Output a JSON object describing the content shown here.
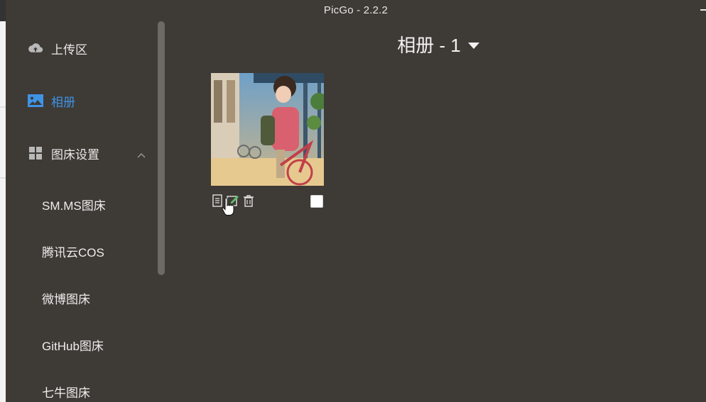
{
  "window": {
    "title": "PicGo - 2.2.2"
  },
  "sidebar": {
    "items": [
      {
        "label": "上传区",
        "icon": "cloud-upload-icon"
      },
      {
        "label": "相册",
        "icon": "image-icon",
        "active": true
      },
      {
        "label": "图床设置",
        "icon": "grid-icon",
        "expanded": true
      }
    ],
    "subitems": [
      {
        "label": "SM.MS图床"
      },
      {
        "label": "腾讯云COS"
      },
      {
        "label": "微博图床"
      },
      {
        "label": "GitHub图床"
      },
      {
        "label": "七牛图床"
      }
    ]
  },
  "main": {
    "album_title": "相册 - 1",
    "images": [
      {
        "alt": "anime girl with bicycle",
        "selected": false
      }
    ],
    "image_actions": [
      "copy-link-icon",
      "edit-icon",
      "delete-icon"
    ]
  },
  "colors": {
    "background": "#3e3a35",
    "accent": "#3f93e6",
    "text": "#e9e9e9"
  }
}
